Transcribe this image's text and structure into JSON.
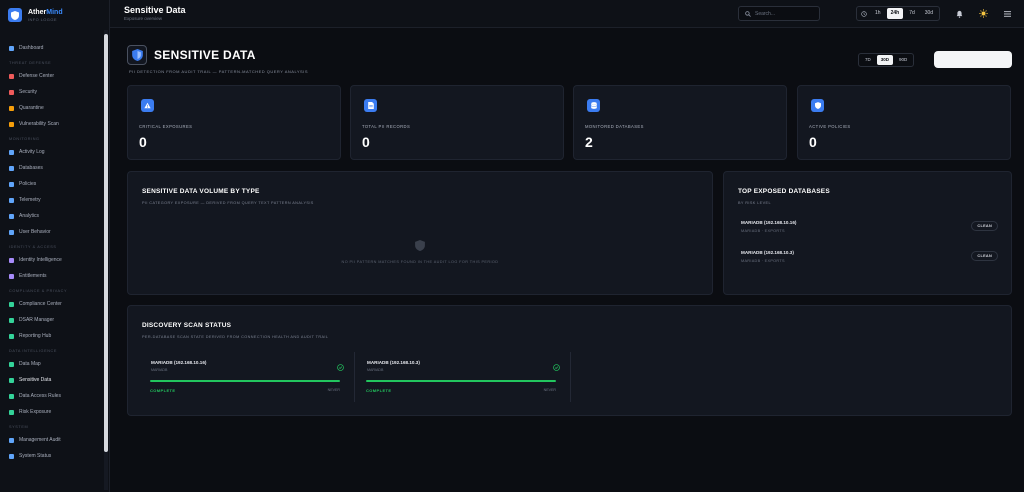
{
  "brand": {
    "name_a": "Ather",
    "name_b": "Mind",
    "sub": "INFO LOGGE"
  },
  "sidebar": {
    "top": [
      {
        "label": "Dashboard",
        "icon": "home-icon"
      }
    ],
    "sections": [
      {
        "title": "THREAT DEFENSE",
        "items": [
          {
            "label": "Defense Center",
            "icon": "rocket-icon",
            "color": "#ef5b5b"
          },
          {
            "label": "Security",
            "icon": "shield-icon",
            "color": "#ef5b5b"
          },
          {
            "label": "Quarantine",
            "icon": "ban-icon",
            "color": "#f59e0b"
          },
          {
            "label": "Vulnerability Scan",
            "icon": "bug-icon",
            "color": "#f59e0b"
          }
        ]
      },
      {
        "title": "MONITORING",
        "items": [
          {
            "label": "Activity Log",
            "icon": "list-icon",
            "color": "#60a5fa"
          },
          {
            "label": "Databases",
            "icon": "database-icon",
            "color": "#60a5fa"
          },
          {
            "label": "Policies",
            "icon": "shield-icon",
            "color": "#60a5fa"
          },
          {
            "label": "Telemetry",
            "icon": "pulse-icon",
            "color": "#60a5fa"
          },
          {
            "label": "Analytics",
            "icon": "chart-icon",
            "color": "#60a5fa"
          },
          {
            "label": "User Behavior",
            "icon": "users-icon",
            "color": "#60a5fa"
          }
        ]
      },
      {
        "title": "IDENTITY & ACCESS",
        "items": [
          {
            "label": "Identity Intelligence",
            "icon": "fingerprint-icon",
            "color": "#a78bfa"
          },
          {
            "label": "Entitlements",
            "icon": "key-icon",
            "color": "#a78bfa"
          }
        ]
      },
      {
        "title": "COMPLIANCE & PRIVACY",
        "items": [
          {
            "label": "Compliance Center",
            "icon": "doc-icon",
            "color": "#34d399"
          },
          {
            "label": "DSAR Manager",
            "icon": "search-icon",
            "color": "#34d399"
          },
          {
            "label": "Reporting Hub",
            "icon": "trend-icon",
            "color": "#34d399"
          }
        ]
      },
      {
        "title": "DATA INTELLIGENCE",
        "items": [
          {
            "label": "Data Map",
            "icon": "map-icon",
            "color": "#34d399"
          },
          {
            "label": "Sensitive Data",
            "icon": "eye-icon",
            "color": "#34d399",
            "active": true
          },
          {
            "label": "Data Access Rules",
            "icon": "rules-icon",
            "color": "#34d399"
          },
          {
            "label": "Risk Exposure",
            "icon": "target-icon",
            "color": "#34d399"
          }
        ]
      },
      {
        "title": "SYSTEM",
        "items": [
          {
            "label": "Management Audit",
            "icon": "doc-icon",
            "color": "#60a5fa"
          },
          {
            "label": "System Status",
            "icon": "gear-icon",
            "color": "#60a5fa"
          }
        ]
      }
    ]
  },
  "topbar": {
    "title": "Sensitive Data",
    "subtitle": "Exposure overview",
    "search_placeholder": "Search...",
    "ranges": [
      "1h",
      "24h",
      "7d",
      "30d"
    ],
    "range_active": "24h"
  },
  "page": {
    "title": "SENSITIVE DATA",
    "description": "PII DETECTION FROM AUDIT TRAIL — PATTERN-MATCHED QUERY ANALYSIS",
    "ranges": [
      "7D",
      "30D",
      "90D"
    ],
    "range_active": "30D",
    "export_label": ""
  },
  "kpis": [
    {
      "label": "CRITICAL EXPOSURES",
      "value": "0",
      "icon": "warning-icon"
    },
    {
      "label": "TOTAL PII RECORDS",
      "value": "0",
      "icon": "file-icon"
    },
    {
      "label": "MONITORED DATABASES",
      "value": "2",
      "icon": "database-icon"
    },
    {
      "label": "ACTIVE POLICIES",
      "value": "0",
      "icon": "shield-icon"
    }
  ],
  "volume": {
    "title": "SENSITIVE DATA VOLUME BY TYPE",
    "subtitle": "PII CATEGORY EXPOSURE — DERIVED FROM QUERY TEXT PATTERN ANALYSIS",
    "empty": "NO PII PATTERN MATCHES FOUND IN THE AUDIT LOG FOR THIS PERIOD"
  },
  "exposed": {
    "title": "TOP EXPOSED DATABASES",
    "subtitle": "BY RISK LEVEL",
    "rows": [
      {
        "name": "MARIADB (192.168.10.16)",
        "type": "MARIADB · EXPORTS",
        "status": "CLEAN"
      },
      {
        "name": "MARIADB (192.168.10.3)",
        "type": "MARIADB · EXPORTS",
        "status": "CLEAN"
      }
    ]
  },
  "scan": {
    "title": "DISCOVERY SCAN STATUS",
    "subtitle": "PER-DATABASE SCAN STATE DERIVED FROM CONNECTION HEALTH AND AUDIT TRAIL",
    "items": [
      {
        "name": "MARIADB (192.168.10.16)",
        "type": "MARIADB",
        "status": "COMPLETE",
        "time": "NEVER",
        "progress": 1.0
      },
      {
        "name": "MARIADB (192.168.10.3)",
        "type": "MARIADB",
        "status": "COMPLETE",
        "time": "NEVER",
        "progress": 1.0
      }
    ]
  },
  "colors": {
    "accent": "#3b7cf0",
    "success": "#22c55e",
    "bg": "#0b0d12",
    "card": "#131720"
  }
}
